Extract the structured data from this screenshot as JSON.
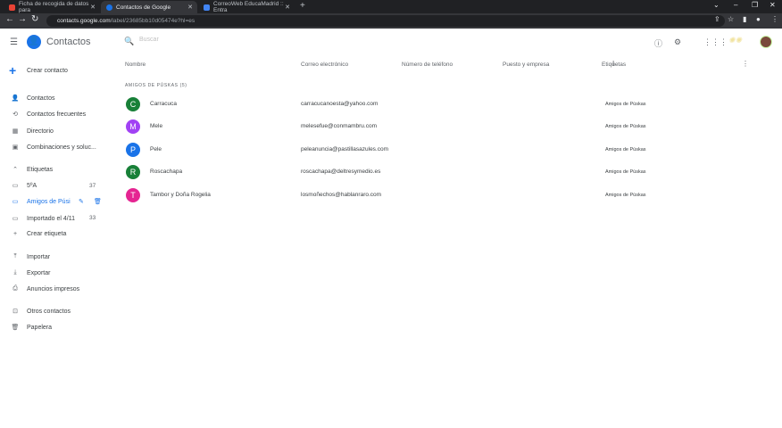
{
  "browser": {
    "tabs": [
      {
        "title": "Ficha de recogida de datos para",
        "color": "#ea4335"
      },
      {
        "title": "Contactos de Google",
        "color": "#1a73e8"
      },
      {
        "title": "CorreoWeb EducaMadrid :: Entra",
        "color": "#4285f4"
      }
    ],
    "url_host": "contacts.google.com",
    "url_path": "/label/23685bb10d05474e?hl=es"
  },
  "header": {
    "app_title": "Contactos",
    "search_placeholder": "Buscar"
  },
  "sidebar": {
    "create_label": "Crear contacto",
    "nav": [
      {
        "label": "Contactos",
        "icon": "person-icon"
      },
      {
        "label": "Contactos frecuentes",
        "icon": "history-icon"
      },
      {
        "label": "Directorio",
        "icon": "domain-icon"
      },
      {
        "label": "Combinaciones y soluc...",
        "icon": "auto-fix-icon"
      }
    ],
    "labels_heading": "Etiquetas",
    "labels": [
      {
        "label": "5ºA",
        "count": "37"
      },
      {
        "label": "Amigos de Púsi",
        "count": ""
      },
      {
        "label": "Importado el 4/11",
        "count": "33"
      }
    ],
    "create_label_link": "Crear etiqueta",
    "tools": [
      {
        "label": "Importar",
        "icon": "upload-icon"
      },
      {
        "label": "Exportar",
        "icon": "download-icon"
      },
      {
        "label": "Anuncios impresos",
        "icon": "print-icon"
      }
    ],
    "other": [
      {
        "label": "Otros contactos",
        "icon": "inbox-icon"
      },
      {
        "label": "Papelera",
        "icon": "trash-icon"
      }
    ]
  },
  "table": {
    "columns": [
      "Nombre",
      "Correo electrónico",
      "Número de teléfono",
      "Puesto y empresa",
      "Etiquetas"
    ],
    "section_title": "AMIGOS DE PÚSKAS (5)",
    "rows": [
      {
        "initial": "C",
        "color": "#188038",
        "name": "Carracuca",
        "email": "carracucanoesta@yahoo.com",
        "label": "Amigos de Púskas"
      },
      {
        "initial": "M",
        "color": "#a142f4",
        "name": "Mele",
        "email": "melesefue@conmambru.com",
        "label": "Amigos de Púskas"
      },
      {
        "initial": "P",
        "color": "#1a73e8",
        "name": "Pele",
        "email": "peleanuncia@pastillasazules.com",
        "label": "Amigos de Púskas"
      },
      {
        "initial": "R",
        "color": "#188038",
        "name": "Roscachapa",
        "email": "roscachapa@deltresymedio.es",
        "label": "Amigos de Púskas"
      },
      {
        "initial": "T",
        "color": "#e52592",
        "name": "Tambor y Doña Rogelia",
        "email": "losmoñechos@hablanraro.com",
        "label": "Amigos de Púskas"
      }
    ]
  }
}
